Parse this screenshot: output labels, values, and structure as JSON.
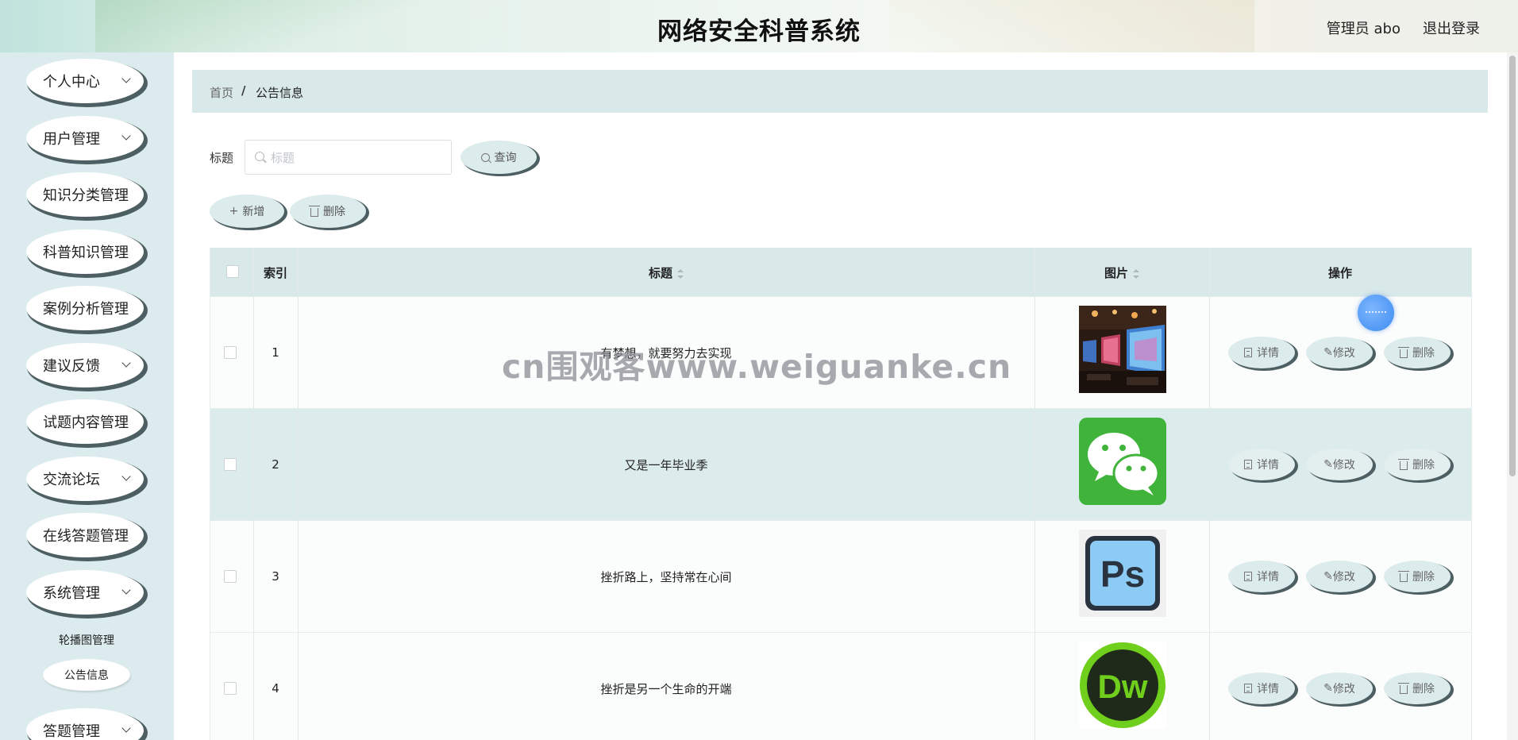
{
  "header": {
    "title": "网络安全科普系统",
    "admin_label": "管理员 abo",
    "logout_label": "退出登录"
  },
  "sidebar": {
    "items": [
      {
        "label": "个人中心",
        "has_arrow": true
      },
      {
        "label": "用户管理",
        "has_arrow": true
      },
      {
        "label": "知识分类管理",
        "has_arrow": false
      },
      {
        "label": "科普知识管理",
        "has_arrow": false
      },
      {
        "label": "案例分析管理",
        "has_arrow": false
      },
      {
        "label": "建议反馈",
        "has_arrow": true
      },
      {
        "label": "试题内容管理",
        "has_arrow": false
      },
      {
        "label": "交流论坛",
        "has_arrow": true
      },
      {
        "label": "在线答题管理",
        "has_arrow": false
      },
      {
        "label": "系统管理",
        "has_arrow": true
      },
      {
        "label": "答题管理",
        "has_arrow": true
      }
    ],
    "sub_items": [
      "轮播图管理",
      "公告信息"
    ],
    "active_sub_item": "公告信息"
  },
  "breadcrumb": {
    "home": "首页",
    "separator": "/",
    "current": "公告信息"
  },
  "search": {
    "label": "标题",
    "placeholder": "标题",
    "value": "",
    "query_button": "查询"
  },
  "actions": {
    "add_label": "新增",
    "delete_label": "删除"
  },
  "table": {
    "columns": [
      "索引",
      "标题",
      "图片",
      "操作"
    ],
    "rows": [
      {
        "index": "1",
        "title": "有梦想，就要努力去实现",
        "image": "gaming-room-photo"
      },
      {
        "index": "2",
        "title": "又是一年毕业季",
        "image": "wechat-logo"
      },
      {
        "index": "3",
        "title": "挫折路上，坚持常在心间",
        "image": "ps-logo"
      },
      {
        "index": "4",
        "title": "挫折是另一个生命的开端",
        "image": "dw-logo"
      }
    ],
    "row_actions": {
      "detail": "详情",
      "edit": "修改",
      "delete": "删除"
    }
  },
  "watermark": "cn围观客www.weiguanke.cn",
  "colors": {
    "sidebar_bg": "#dcecee",
    "header_bar_bg": "#d9e9ea",
    "pill_shadow": "#4d5f62",
    "row_highlight": "#dcecec"
  }
}
